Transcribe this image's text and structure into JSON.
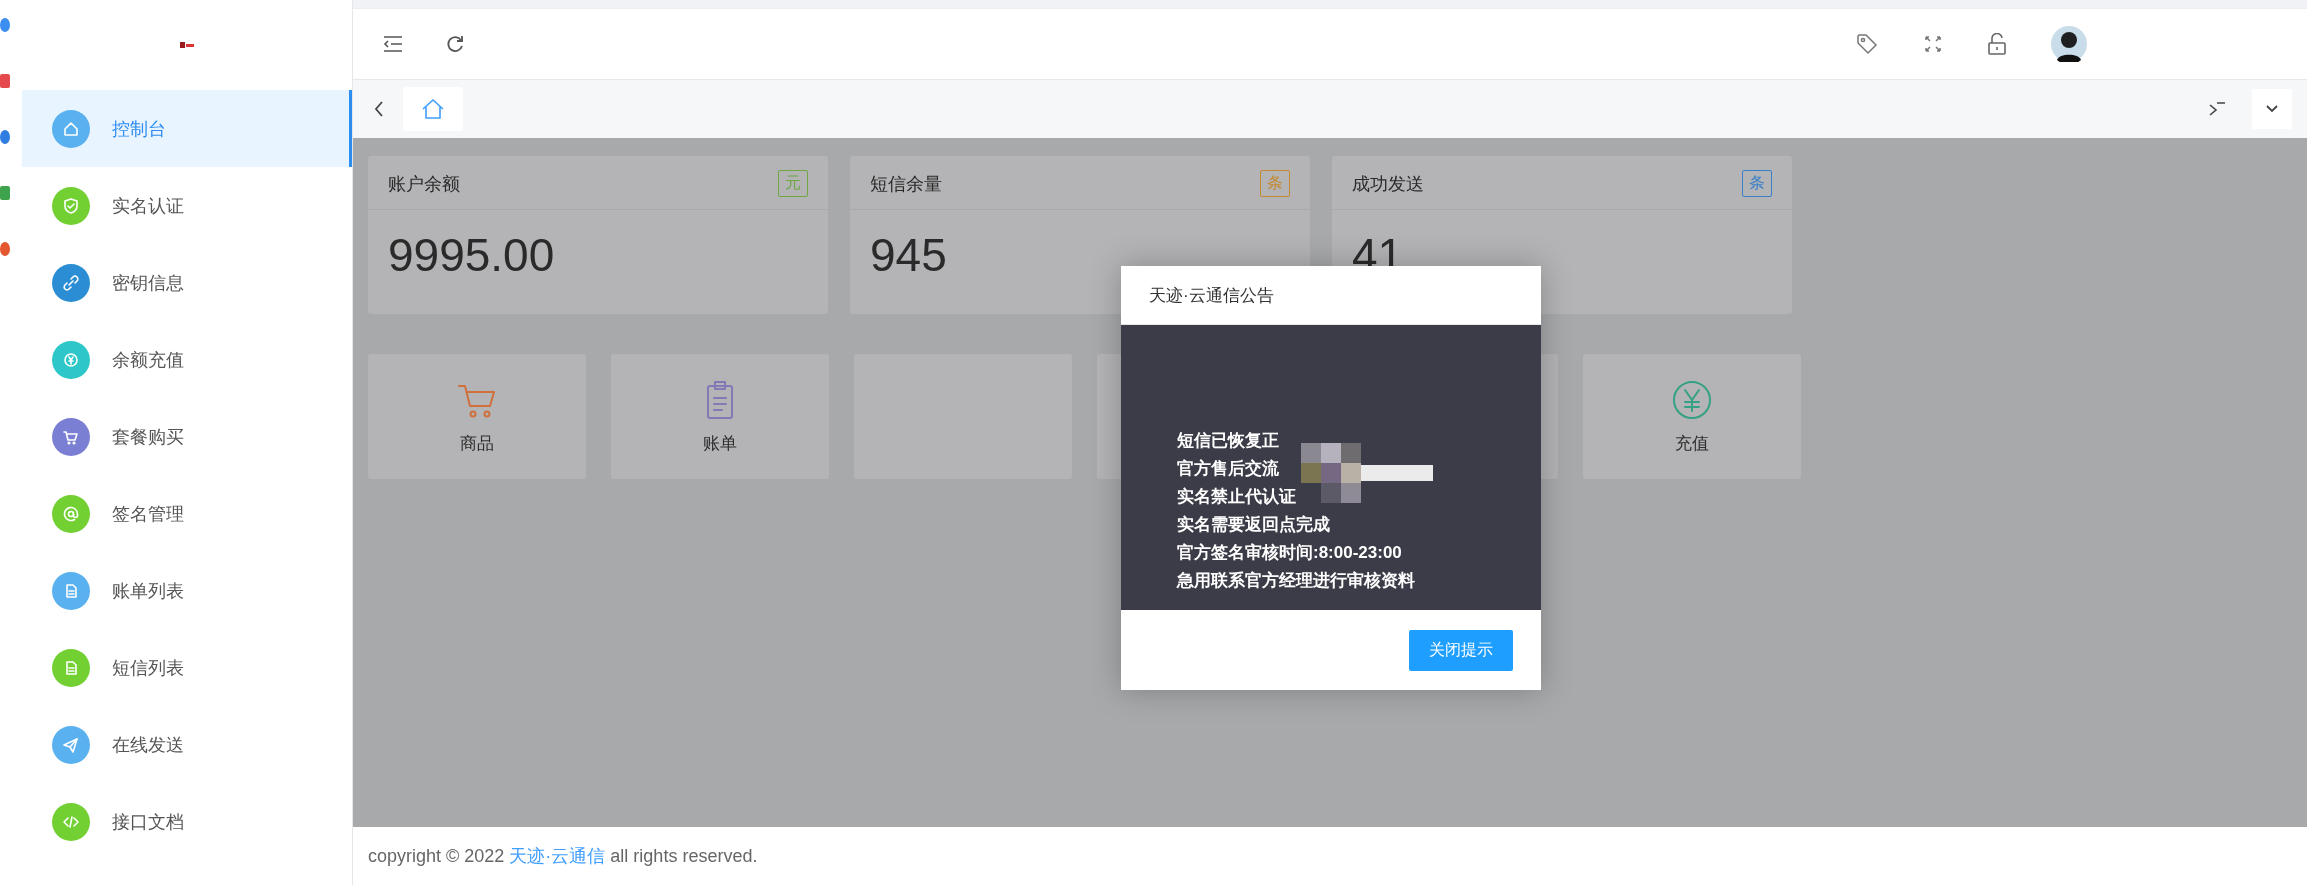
{
  "sidebar": {
    "items": [
      {
        "label": "控制台",
        "kind": "home",
        "color": "#5ab1ef",
        "selected": true
      },
      {
        "label": "实名认证",
        "kind": "shield",
        "color": "#72d033",
        "selected": false
      },
      {
        "label": "密钥信息",
        "kind": "link",
        "color": "#2b8ed5",
        "selected": false
      },
      {
        "label": "余额充值",
        "kind": "yen",
        "color": "#2ec7c9",
        "selected": false
      },
      {
        "label": "套餐购买",
        "kind": "cart",
        "color": "#7b7fd4",
        "selected": false
      },
      {
        "label": "签名管理",
        "kind": "at",
        "color": "#72d033",
        "selected": false
      },
      {
        "label": "账单列表",
        "kind": "doc",
        "color": "#5ab1ef",
        "selected": false
      },
      {
        "label": "短信列表",
        "kind": "doc",
        "color": "#72d033",
        "selected": false
      },
      {
        "label": "在线发送",
        "kind": "send",
        "color": "#5ab1ef",
        "selected": false
      },
      {
        "label": "接口文档",
        "kind": "code",
        "color": "#72d033",
        "selected": false
      }
    ]
  },
  "tabs": [
    {
      "kind": "home",
      "selected": true
    }
  ],
  "stats": [
    {
      "title": "账户余额",
      "unit": "元",
      "color": "#6fa843",
      "value": "9995.00"
    },
    {
      "title": "短信余量",
      "unit": "条",
      "color": "#c48a32",
      "value": "945"
    },
    {
      "title": "成功发送",
      "unit": "条",
      "color": "#3a80c8",
      "value": "41"
    }
  ],
  "shortcuts": [
    {
      "label": "商品",
      "kind": "cart",
      "color": "#d0703c"
    },
    {
      "label": "账单",
      "kind": "clipboard",
      "color": "#837ab5"
    },
    {
      "label": "充值",
      "kind": "yen",
      "color": "#35a083"
    }
  ],
  "modal": {
    "title": "天迹·云通信公告",
    "lines": [
      "短信已恢复正",
      "官方售后交流",
      "实名禁止代认证",
      "实名需要返回点完成",
      "官方签名审核时间:8:00-23:00",
      "急用联系官方经理进行审核资料"
    ],
    "button": "关闭提示"
  },
  "footer": {
    "prefix": "copyright © 2022",
    "link": "天迹·云通信",
    "suffix": "all rights reserved."
  }
}
